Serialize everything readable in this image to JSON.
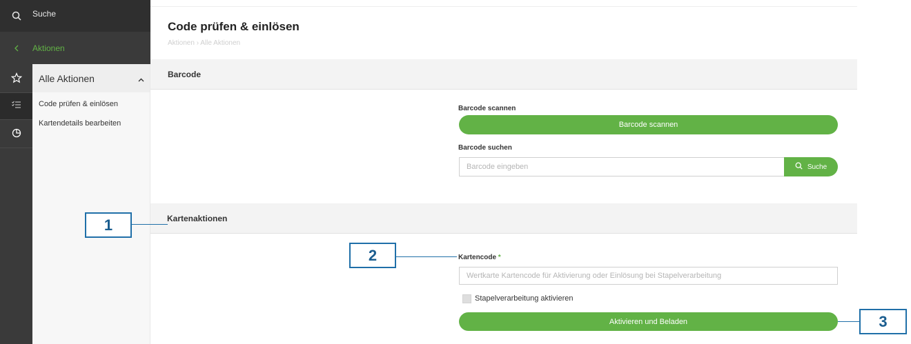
{
  "sidebar": {
    "search_label": "Suche",
    "back_label": "Aktionen",
    "section_title": "Alle Aktionen",
    "items": [
      {
        "label": "Code prüfen & einlösen"
      },
      {
        "label": "Kartendetails bearbeiten"
      }
    ]
  },
  "header": {
    "title": "Code prüfen & einlösen",
    "breadcrumb": "Aktionen › Alle Aktionen"
  },
  "barcode_section": {
    "title": "Barcode",
    "scan_label": "Barcode scannen",
    "scan_button": "Barcode scannen",
    "search_label": "Barcode suchen",
    "search_placeholder": "Barcode eingeben",
    "search_button": "Suche"
  },
  "card_section": {
    "title": "Kartenaktionen",
    "code_label": "Kartencode",
    "required_mark": "*",
    "code_placeholder": "Wertkarte Kartencode für Aktivierung oder Einlösung bei Stapelverarbeitung",
    "batch_label": "Stapelverarbeitung aktivieren",
    "batch_checked": false,
    "submit_button": "Aktivieren und Beladen"
  },
  "callouts": [
    "1",
    "2",
    "3"
  ],
  "colors": {
    "accent": "#62b246",
    "rail": "#3a3a3a",
    "callout": "#1f6fa8"
  }
}
